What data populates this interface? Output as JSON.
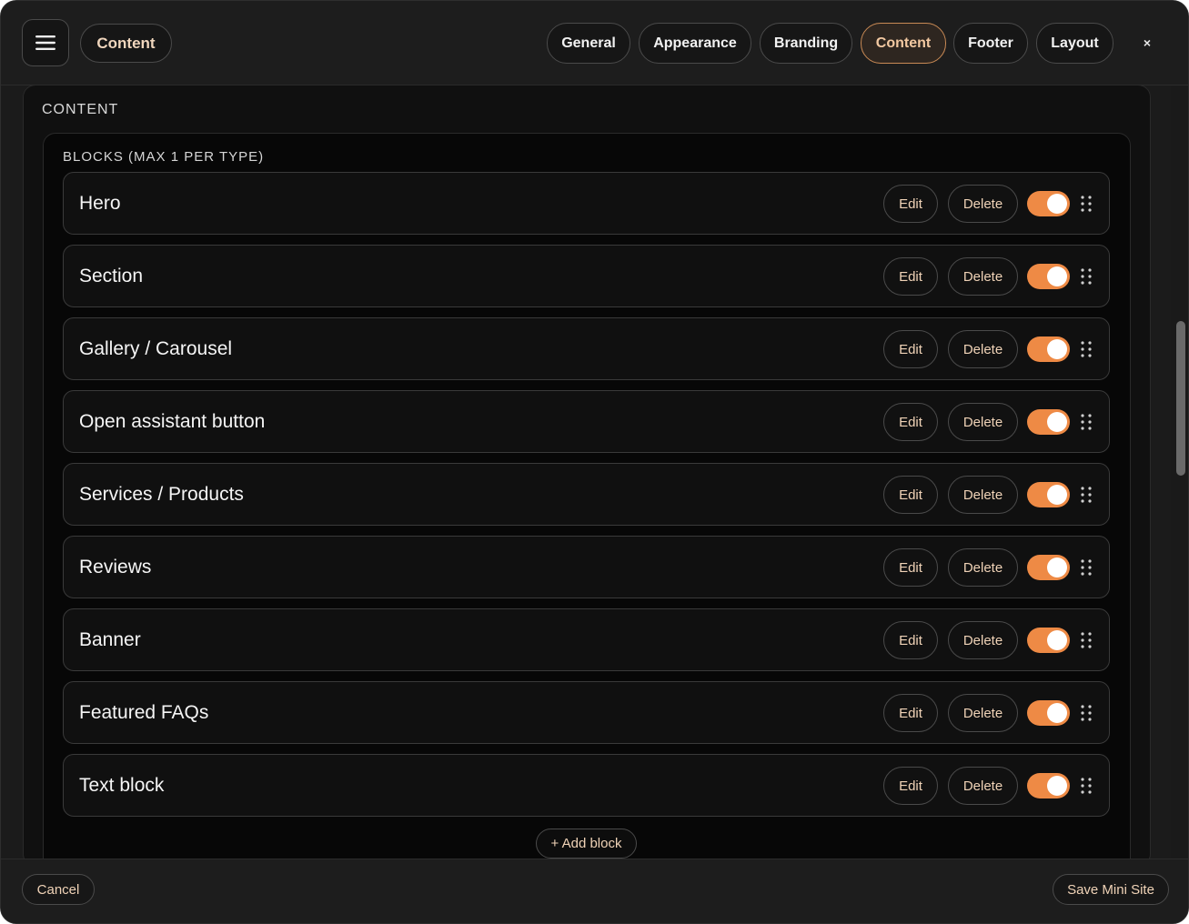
{
  "header": {
    "breadcrumb": "Content",
    "tabs": [
      {
        "label": "General",
        "active": false
      },
      {
        "label": "Appearance",
        "active": false
      },
      {
        "label": "Branding",
        "active": false
      },
      {
        "label": "Content",
        "active": true
      },
      {
        "label": "Footer",
        "active": false
      },
      {
        "label": "Layout",
        "active": false
      }
    ],
    "close_label": "×"
  },
  "content": {
    "title": "CONTENT",
    "blocks_title": "BLOCKS (MAX 1 PER TYPE)",
    "edit_label": "Edit",
    "delete_label": "Delete",
    "blocks": [
      {
        "label": "Hero",
        "enabled": true
      },
      {
        "label": "Section",
        "enabled": true
      },
      {
        "label": "Gallery / Carousel",
        "enabled": true
      },
      {
        "label": "Open assistant button",
        "enabled": true
      },
      {
        "label": "Services / Products",
        "enabled": true
      },
      {
        "label": "Reviews",
        "enabled": true
      },
      {
        "label": "Banner",
        "enabled": true
      },
      {
        "label": "Featured FAQs",
        "enabled": true
      },
      {
        "label": "Text block",
        "enabled": true
      }
    ],
    "add_block_label": "+ Add block"
  },
  "footer": {
    "cancel_label": "Cancel",
    "save_label": "Save Mini Site"
  },
  "colors": {
    "accent": "#ee8a45",
    "background": "#1b1b1b",
    "active_tab_border": "#c98a55"
  },
  "icons": {
    "menu": "hamburger-icon",
    "close": "close-icon",
    "drag": "drag-handle-icon"
  }
}
